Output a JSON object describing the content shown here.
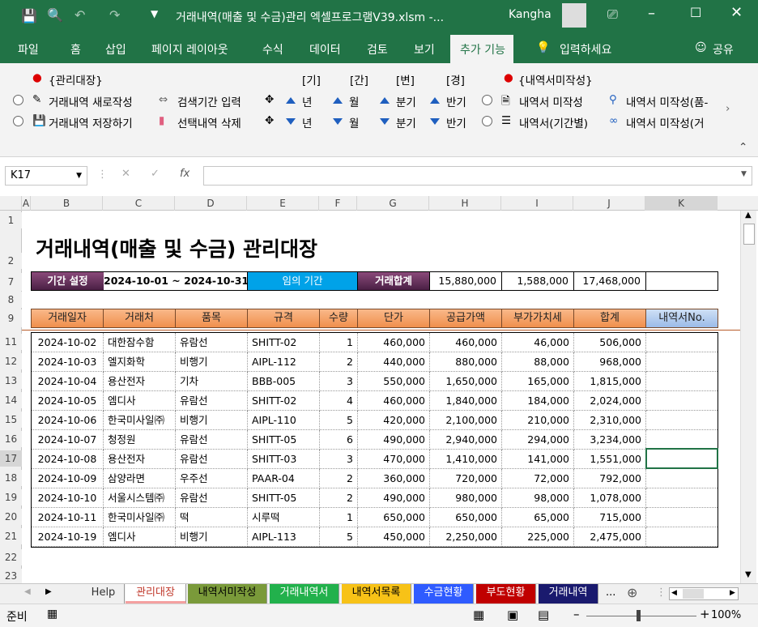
{
  "window": {
    "title": "거래내역(매출 및 수금)관리 엑셀프로그램V39.xlsm  -...",
    "user": "Kangha"
  },
  "tabs": [
    "파일",
    "홈",
    "삽입",
    "페이지 레이아웃",
    "수식",
    "데이터",
    "검토",
    "보기",
    "추가 기능",
    "입력하세요",
    "공유"
  ],
  "ribbon": {
    "group1_title": "{관리대장}",
    "new_entry": "거래내역 새로작성",
    "save_entry": "거래내역 저장하기",
    "search_period": "검색기간 입력",
    "delete_selected": "선택내역 삭제",
    "period_headers": [
      "[기]",
      "[간]",
      "[변]",
      "[경]"
    ],
    "year": "년",
    "month": "월",
    "quarter": "분기",
    "half": "반기",
    "group2_title": "{내역서미작성}",
    "inv_unwritten": "내역서 미작성",
    "inv_period": "내역서(기간별)",
    "inv_unwritten_item": "내역서 미작성(품-",
    "inv_unwritten_tx": "내역서 미작성(거"
  },
  "formula": {
    "namebox": "K17",
    "value": ""
  },
  "columns": [
    "A",
    "B",
    "C",
    "D",
    "E",
    "F",
    "G",
    "H",
    "I",
    "J",
    "K"
  ],
  "sheet": {
    "title": "거래내역(매출 및 수금) 관리대장",
    "period_label": "기간 설정",
    "period_value": "2024-10-01 ~ 2024-10-31",
    "period_mode": "임의 기간",
    "total_label": "거래합계",
    "total_supply": "15,880,000",
    "total_vat": "1,588,000",
    "total_sum": "17,468,000",
    "headers": [
      "거래일자",
      "거래처",
      "품목",
      "규격",
      "수량",
      "단가",
      "공급가액",
      "부가가치세",
      "합계",
      "내역서No."
    ],
    "rows": [
      [
        "2024-10-02",
        "대한잠수함",
        "유람선",
        "SHITT-02",
        "1",
        "460,000",
        "460,000",
        "46,000",
        "506,000",
        ""
      ],
      [
        "2024-10-03",
        "엘지화학",
        "비행기",
        "AIPL-112",
        "2",
        "440,000",
        "880,000",
        "88,000",
        "968,000",
        ""
      ],
      [
        "2024-10-04",
        "용산전자",
        "기차",
        "BBB-005",
        "3",
        "550,000",
        "1,650,000",
        "165,000",
        "1,815,000",
        ""
      ],
      [
        "2024-10-05",
        "엠디사",
        "유람선",
        "SHITT-02",
        "4",
        "460,000",
        "1,840,000",
        "184,000",
        "2,024,000",
        ""
      ],
      [
        "2024-10-06",
        "한국미사일㈜",
        "비행기",
        "AIPL-110",
        "5",
        "420,000",
        "2,100,000",
        "210,000",
        "2,310,000",
        ""
      ],
      [
        "2024-10-07",
        "청정원",
        "유람선",
        "SHITT-05",
        "6",
        "490,000",
        "2,940,000",
        "294,000",
        "3,234,000",
        ""
      ],
      [
        "2024-10-08",
        "용산전자",
        "유람선",
        "SHITT-03",
        "3",
        "470,000",
        "1,410,000",
        "141,000",
        "1,551,000",
        ""
      ],
      [
        "2024-10-09",
        "삼양라면",
        "우주선",
        "PAAR-04",
        "2",
        "360,000",
        "720,000",
        "72,000",
        "792,000",
        ""
      ],
      [
        "2024-10-10",
        "서울시스템㈜",
        "유람선",
        "SHITT-05",
        "2",
        "490,000",
        "980,000",
        "98,000",
        "1,078,000",
        ""
      ],
      [
        "2024-10-11",
        "한국미사일㈜",
        "떡",
        "시루떡",
        "1",
        "650,000",
        "650,000",
        "65,000",
        "715,000",
        ""
      ],
      [
        "2024-10-19",
        "엠디사",
        "비행기",
        "AIPL-113",
        "5",
        "450,000",
        "2,250,000",
        "225,000",
        "2,475,000",
        ""
      ]
    ],
    "row_numbers": [
      "1",
      "2",
      "7",
      "8",
      "9",
      "11",
      "12",
      "13",
      "14",
      "15",
      "16",
      "17",
      "18",
      "19",
      "20",
      "21",
      "22",
      "23"
    ]
  },
  "sheet_tabs": [
    {
      "label": "Help",
      "color": "#f0f0f0",
      "text": "#333"
    },
    {
      "label": "관리대장",
      "color": "#ffffff",
      "text": "#c0392b"
    },
    {
      "label": "내역서미작성",
      "color": "#7a9a3a",
      "text": "#000"
    },
    {
      "label": "거래내역서",
      "color": "#22b14c",
      "text": "#fff"
    },
    {
      "label": "내역서목록",
      "color": "#f7c217",
      "text": "#000"
    },
    {
      "label": "수금현황",
      "color": "#2f5bff",
      "text": "#fff"
    },
    {
      "label": "부도현황",
      "color": "#c00000",
      "text": "#fff"
    },
    {
      "label": "거래내역",
      "color": "#1a1a6e",
      "text": "#fff"
    }
  ],
  "more_tabs": "...",
  "status": {
    "ready": "준비",
    "zoom": "100%"
  }
}
